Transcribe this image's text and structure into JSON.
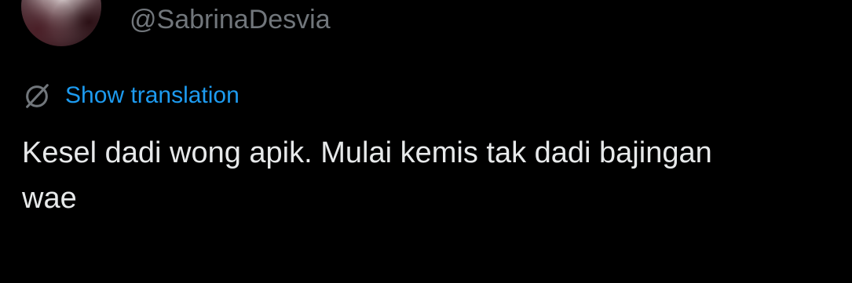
{
  "author": {
    "handle": "@SabrinaDesvia"
  },
  "translation": {
    "link_label": "Show translation"
  },
  "tweet": {
    "line1": "Kesel dadi wong apik. Mulai kemis tak dadi bajingan",
    "line2": "wae"
  },
  "icons": {
    "translate": "globe-slash-icon",
    "avatar": "profile-avatar"
  },
  "colors": {
    "background": "#000000",
    "text": "#e7e9ea",
    "muted": "#71767b",
    "link": "#1d9bf0"
  }
}
